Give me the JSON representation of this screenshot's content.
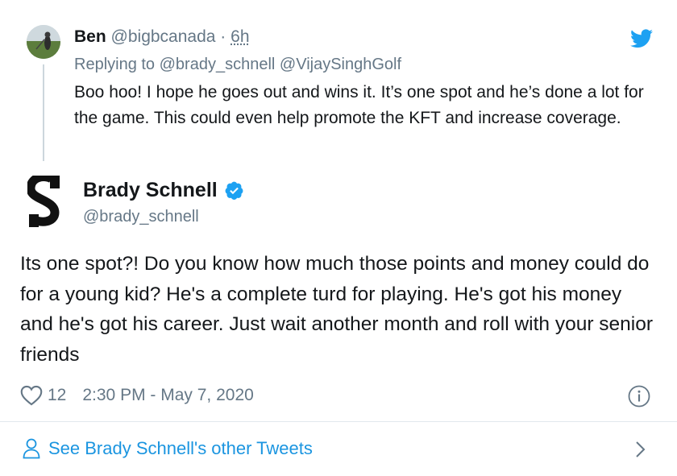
{
  "reply": {
    "author_name": "Ben",
    "author_handle": "@bigbcanada",
    "separator": "·",
    "time": "6h",
    "replying_label": "Replying to",
    "mentions": [
      "@brady_schnell",
      "@VijaySinghGolf"
    ],
    "text": "Boo hoo! I hope he goes out and wins it. It’s one spot and he’s done a lot for the game. This could even help promote the KFT and increase coverage."
  },
  "tweet": {
    "logo_letter": "S",
    "author_name": "Brady Schnell",
    "author_handle": "@brady_schnell",
    "text": "Its one spot?! Do you know how much those points and money could do for a young kid? He's a complete turd for playing. He's got his money and he's got his career. Just wait another month and roll with your senior friends",
    "like_count": "12",
    "timestamp": "2:30 PM - May 7, 2020"
  },
  "footer": {
    "link_label": "See Brady Schnell's other Tweets"
  },
  "icons": {
    "bird": "twitter-bird-icon",
    "verified": "verified-badge-icon",
    "like": "heart-icon",
    "info": "info-icon",
    "person": "person-icon",
    "chevron": "chevron-right-icon"
  },
  "colors": {
    "twitter_blue": "#1da1f2",
    "link_blue": "#1b95e0",
    "secondary_text": "#657786",
    "primary_text": "#14171a",
    "divider": "#e1e8ed"
  }
}
